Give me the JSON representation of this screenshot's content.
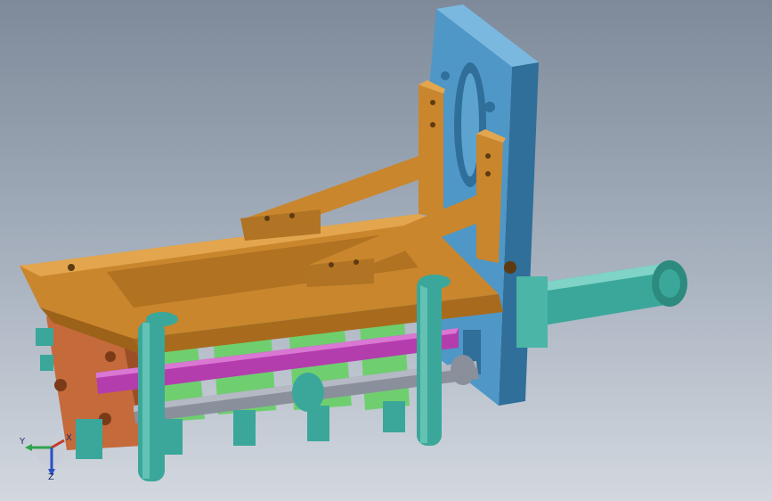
{
  "viewport": {
    "background_top": "#7e8a9a",
    "background_bottom": "#d3d8df"
  },
  "colors": {
    "bracket_orange": "#c9862d",
    "plate_blue": "#4f97c7",
    "rust_block": "#c46a3b",
    "green_block": "#6fcf6f",
    "teal_part": "#3aa79a",
    "magenta_rod": "#b43dae",
    "gray_shaft": "#8a8f9c"
  },
  "triad": {
    "x_label": "X",
    "y_label": "Y",
    "z_label": "Z",
    "x_color": "#c23a2a",
    "y_color": "#2fa44a",
    "z_color": "#2a4fc2"
  }
}
